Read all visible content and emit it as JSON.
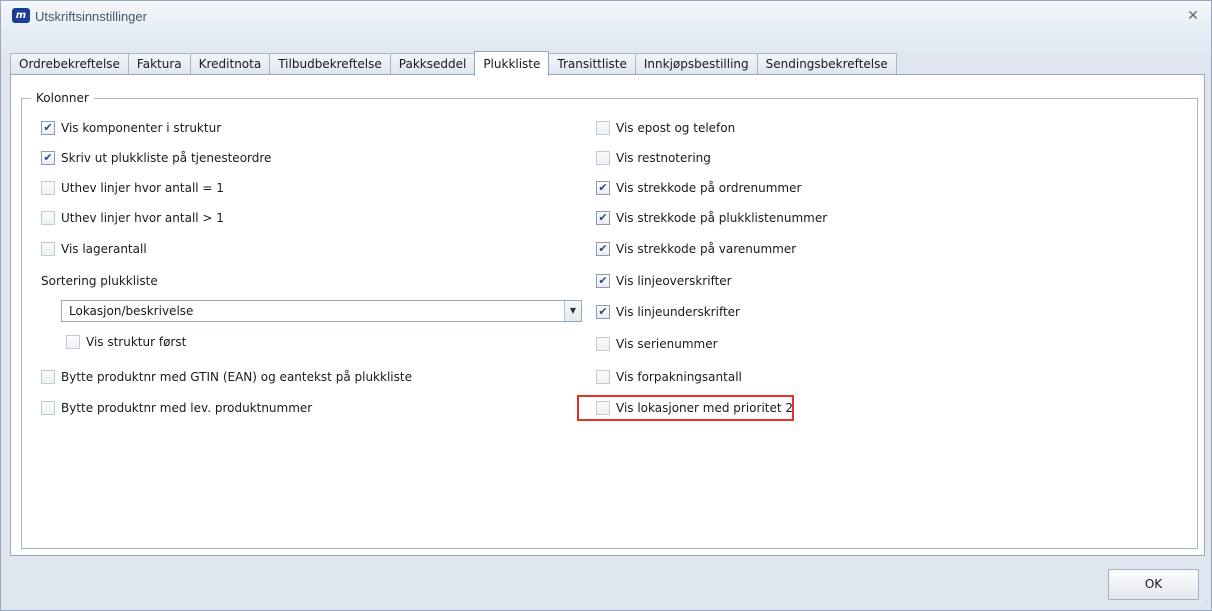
{
  "window": {
    "title": "Utskriftsinnstillinger",
    "app_icon_text": "m",
    "close_symbol": "✕"
  },
  "tabs": [
    {
      "label": "Ordrebekreftelse",
      "active": false
    },
    {
      "label": "Faktura",
      "active": false
    },
    {
      "label": "Kreditnota",
      "active": false
    },
    {
      "label": "Tilbudbekreftelse",
      "active": false
    },
    {
      "label": "Pakkseddel",
      "active": false
    },
    {
      "label": "Plukkliste",
      "active": true
    },
    {
      "label": "Transittliste",
      "active": false
    },
    {
      "label": "Innkjøpsbestilling",
      "active": false
    },
    {
      "label": "Sendingsbekreftelse",
      "active": false
    }
  ],
  "group": {
    "legend": "Kolonner"
  },
  "left_options": [
    {
      "label": "Vis komponenter i struktur",
      "checked": true
    },
    {
      "label": "Skriv ut plukkliste på tjenesteordre",
      "checked": true
    },
    {
      "label": "Uthev linjer hvor antall = 1",
      "checked": false
    },
    {
      "label": "Uthev linjer hvor antall > 1",
      "checked": false
    },
    {
      "label": "Vis lagerantall",
      "checked": false
    }
  ],
  "sorting": {
    "label": "Sortering plukkliste",
    "selected": "Lokasjon/beskrivelse",
    "sub_option": {
      "label": "Vis struktur først",
      "checked": false
    }
  },
  "left_options_bottom": [
    {
      "label": "Bytte produktnr med GTIN (EAN) og eantekst på plukkliste",
      "checked": false
    },
    {
      "label": "Bytte produktnr med lev. produktnummer",
      "checked": false
    }
  ],
  "right_options": [
    {
      "label": "Vis epost og telefon",
      "checked": false
    },
    {
      "label": "Vis restnotering",
      "checked": false
    },
    {
      "label": "Vis strekkode på ordrenummer",
      "checked": true
    },
    {
      "label": "Vis strekkode på plukklistenummer",
      "checked": true
    },
    {
      "label": "Vis strekkode på varenummer",
      "checked": true
    },
    {
      "label": "Vis linjeoverskrifter",
      "checked": true
    },
    {
      "label": "Vis linjeunderskrifter",
      "checked": true
    },
    {
      "label": "Vis serienummer",
      "checked": false
    },
    {
      "label": "Vis forpakningsantall",
      "checked": false
    },
    {
      "label": "Vis lokasjoner med prioritet 2",
      "checked": false
    }
  ],
  "buttons": {
    "ok": "OK"
  },
  "colors": {
    "highlight": "#e3312b",
    "accent": "#1c3d92"
  }
}
